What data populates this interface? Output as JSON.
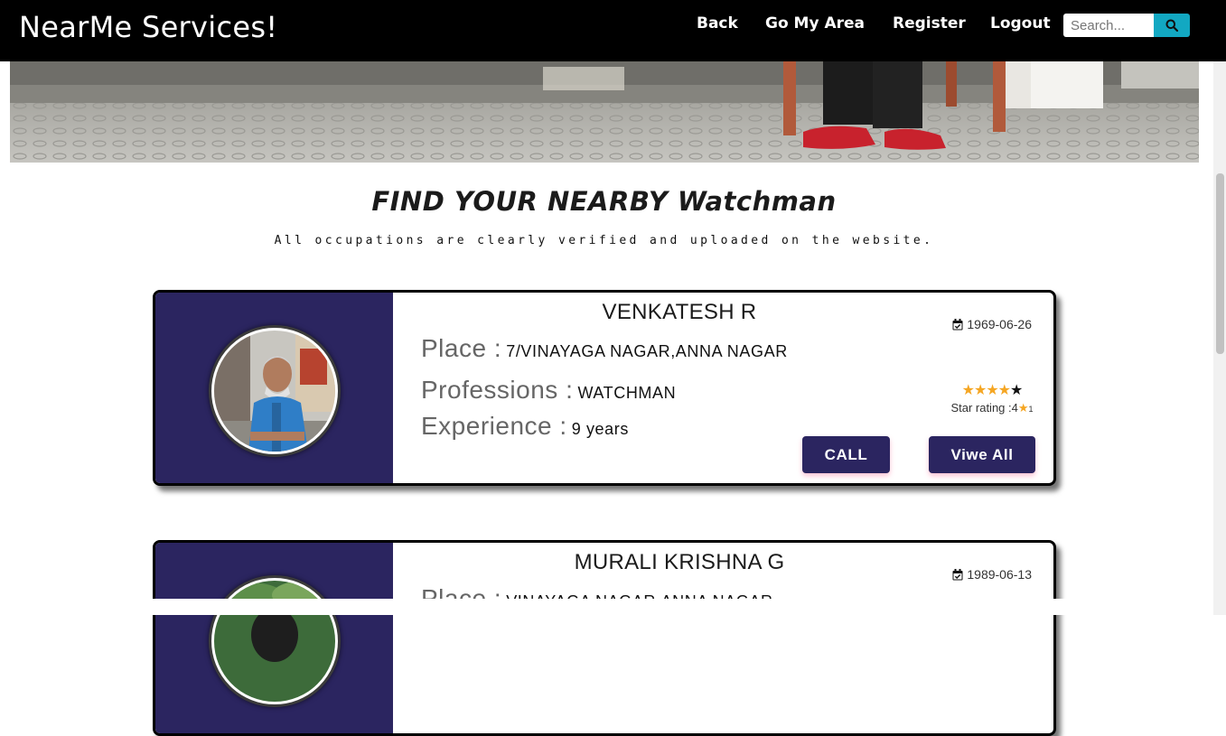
{
  "navbar": {
    "brand": "NearMe Services!",
    "links": [
      "Back",
      "Go My Area",
      "Register",
      "Logout"
    ],
    "search_placeholder": "Search..."
  },
  "heading": {
    "title": "FIND YOUR NEARBY Watchman",
    "subtitle": "All occupations are clearly verified and uploaded on the website."
  },
  "labels": {
    "place": "Place :",
    "profession": "Professions :",
    "experience": "Experience :",
    "call": "CALL",
    "view_all": "Viwe All"
  },
  "workers": [
    {
      "name": "VENKATESH R",
      "dob": "1969-06-26",
      "place": "7/VINAYAGA NAGAR,ANNA NAGAR",
      "profession": "WATCHMAN",
      "experience": "9 years",
      "stars_filled": 4,
      "stars_total": 5,
      "rating_label": "Star rating :4",
      "rating_suffix": "1"
    },
    {
      "name": "MURALI KRISHNA G",
      "dob": "1989-06-13",
      "place": "VINAYAGA NAGAR,ANNA NAGAR"
    }
  ],
  "colors": {
    "navbar_bg": "#000000",
    "card_accent": "#2b2560",
    "search_button": "#12a8c2",
    "star": "#f5a623"
  }
}
